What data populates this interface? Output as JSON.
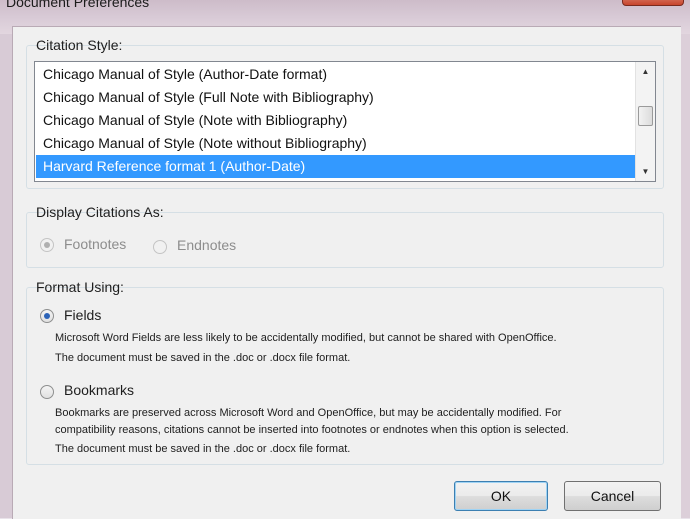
{
  "window": {
    "title": "Document Preferences"
  },
  "citation_style": {
    "label": "Citation Style:",
    "items": [
      "Chicago Manual of Style (Author-Date format)",
      "Chicago Manual of Style (Full Note with Bibliography)",
      "Chicago Manual of Style (Note with Bibliography)",
      "Chicago Manual of Style (Note without Bibliography)",
      "Harvard Reference format 1 (Author-Date)"
    ],
    "selected": "Harvard Reference format 1 (Author-Date)"
  },
  "display_citations": {
    "label": "Display Citations As:",
    "footnotes": "Footnotes",
    "endnotes": "Endnotes",
    "selected": "Footnotes",
    "enabled": false
  },
  "format_using": {
    "label": "Format Using:",
    "fields": {
      "label": "Fields",
      "desc1": "Microsoft Word Fields are less likely to be accidentally modified, but cannot be shared with OpenOffice.",
      "desc2": "The document must be saved in the .doc or .docx file format."
    },
    "bookmarks": {
      "label": "Bookmarks",
      "desc1": "Bookmarks are preserved across Microsoft Word and OpenOffice, but may be accidentally modified. For",
      "desc2": "compatibility reasons, citations cannot be inserted into footnotes or endnotes when this option is selected.",
      "desc3": "The document must be saved in the .doc or .docx file format."
    },
    "selected": "Fields"
  },
  "buttons": {
    "ok": "OK",
    "cancel": "Cancel"
  }
}
